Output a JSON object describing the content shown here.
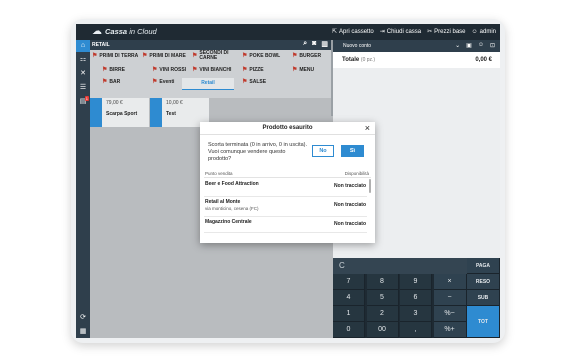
{
  "topbar": {
    "brand_a": "Cassa",
    "brand_b": "in Cloud",
    "actions": [
      {
        "icon": "external-link-icon",
        "glyph": "⇱",
        "label": "Apri cassetto"
      },
      {
        "icon": "logout-icon",
        "glyph": "⇥",
        "label": "Chiudi cassa"
      },
      {
        "icon": "tag-icon",
        "glyph": "✂",
        "label": "Prezzi base"
      },
      {
        "icon": "user-icon",
        "glyph": "☺",
        "label": "admin"
      }
    ]
  },
  "sidebar": {
    "items": [
      {
        "icon": "home-icon",
        "glyph": "⌂"
      },
      {
        "icon": "tables-icon",
        "glyph": "⚏"
      },
      {
        "icon": "fork-knife-icon",
        "glyph": "✕"
      },
      {
        "icon": "list-icon",
        "glyph": "☰"
      },
      {
        "icon": "orders-icon",
        "glyph": "▤",
        "badge": "1"
      },
      {
        "icon": "refresh-icon",
        "glyph": "⟳"
      },
      {
        "icon": "grid-icon",
        "glyph": "▦"
      }
    ]
  },
  "catbar": {
    "title": "RETAIL"
  },
  "categories": [
    {
      "label": "PRIMI DI TERRA",
      "icon": "food-icon",
      "glyph": "⚑"
    },
    {
      "label": "PRIMI DI MARE",
      "icon": "food-icon",
      "glyph": "⚑"
    },
    {
      "label": "SECONDI DI CARNE",
      "icon": "food-icon",
      "glyph": "⚑"
    },
    {
      "label": "POKE BOWL",
      "icon": "food-icon",
      "glyph": "⚑"
    },
    {
      "label": "BURGER",
      "icon": "food-icon",
      "glyph": "⚑"
    },
    {
      "label": "BIRRE",
      "icon": "drink-icon",
      "glyph": "⚑"
    },
    {
      "label": "VINI ROSSI",
      "icon": "drink-icon",
      "glyph": "⚑"
    },
    {
      "label": "VINI BIANCHI",
      "icon": "drink-icon",
      "glyph": "⚑"
    },
    {
      "label": "PIZZE",
      "icon": "food-icon",
      "glyph": "⚑"
    },
    {
      "label": "MENU",
      "icon": "food-icon",
      "glyph": "⚑"
    },
    {
      "label": "BAR",
      "icon": "drink-icon",
      "glyph": "⚑"
    },
    {
      "label": "Eventi",
      "icon": "event-icon",
      "glyph": "⚑"
    },
    {
      "label": "Retail",
      "icon": "",
      "glyph": ""
    },
    {
      "label": "SALSE",
      "icon": "food-icon",
      "glyph": "⚑"
    }
  ],
  "products": [
    {
      "price": "79,00 €",
      "name": "Scarpa Sport"
    },
    {
      "price": "10,00 €",
      "name": "Test"
    }
  ],
  "right_panel": {
    "conto": "Nuovo conto",
    "total_label": "Totale",
    "total_count": "(0 pz.)",
    "total_value": "0,00 €"
  },
  "keypad": {
    "display": "C",
    "keys": [
      "7",
      "8",
      "9",
      "×",
      "4",
      "5",
      "6",
      "−",
      "1",
      "2",
      "3",
      "%−",
      "0",
      "00",
      ",",
      "%+"
    ],
    "side": [
      "PAGA",
      "RESO",
      "SUB",
      "TOT"
    ]
  },
  "modal": {
    "title": "Prodotto esaurito",
    "message": "Scorta terminata (0 in arrivo, 0 in uscita). Vuoi comunque vendere questo prodotto?",
    "btn_no": "No",
    "btn_si": "Sì",
    "col_point": "Punto vendita",
    "col_avail": "Disponibilità",
    "rows": [
      {
        "name": "Beer e Food Attraction",
        "address": "",
        "status": "Non tracciato"
      },
      {
        "name": "Retail al Monte",
        "address": "via monticino, cesena (FC)",
        "status": "Non tracciato"
      },
      {
        "name": "Magazzino Centrale",
        "address": "",
        "status": "Non tracciato"
      }
    ]
  }
}
